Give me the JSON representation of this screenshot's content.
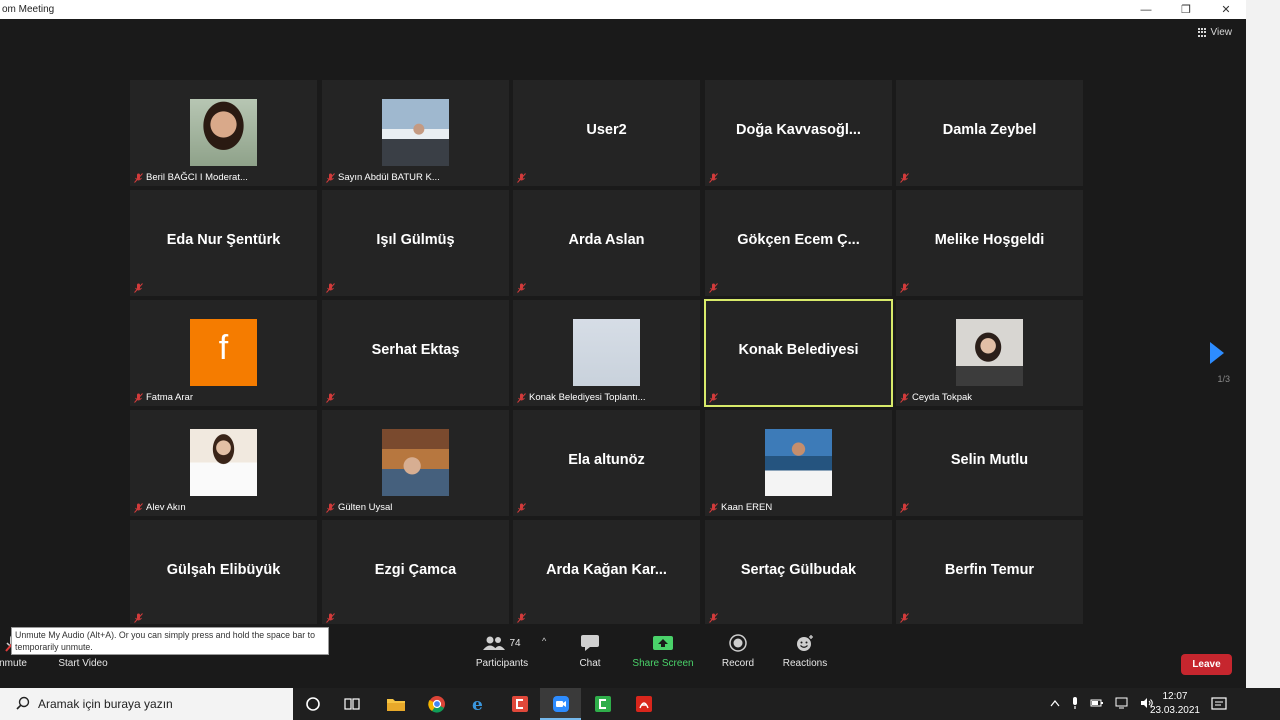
{
  "window": {
    "title": "om Meeting",
    "minimize": "—",
    "restore": "❐",
    "close": "✕"
  },
  "view_label": "View",
  "tiles": [
    {
      "name": "Beril BAĞCI I Moderat...",
      "photo": "woman-curly-hair"
    },
    {
      "name": "Sayın Abdül BATUR K...",
      "photo": "man-outdoors"
    },
    {
      "name": "User2"
    },
    {
      "name": "Doğa  Kavvasoğl..."
    },
    {
      "name": "Damla Zeybel"
    },
    {
      "name": "Eda Nur Şentürk"
    },
    {
      "name": "Işıl Gülmüş"
    },
    {
      "name": "Arda Aslan"
    },
    {
      "name": "Gökçen  Ecem  Ç..."
    },
    {
      "name": "Melike Hoşgeldi"
    },
    {
      "name": "Fatma Arar",
      "photo": "facebook-logo",
      "logo_letter": "f"
    },
    {
      "name": "Serhat Ektaş"
    },
    {
      "name": "Konak Belediyesi Toplantı...",
      "photo": "blank-light"
    },
    {
      "name": "Konak Belediyesi",
      "active": true
    },
    {
      "name": "Ceyda Tokpak",
      "photo": "woman-portrait"
    },
    {
      "name": "Alev Akın",
      "photo": "woman-white-dress"
    },
    {
      "name": "Gülten Uysal",
      "photo": "woman-lying"
    },
    {
      "name": "Ela altunöz"
    },
    {
      "name": "Kaan EREN",
      "photo": "man-seaside"
    },
    {
      "name": "Selin Mutlu"
    },
    {
      "name": "Gülşah Elibüyük"
    },
    {
      "name": "Ezgi Çamca"
    },
    {
      "name": "Arda Kağan  Kar..."
    },
    {
      "name": "Sertaç Gülbudak"
    },
    {
      "name": "Berfin Temur"
    }
  ],
  "pager": {
    "text": "1/3"
  },
  "controls": {
    "unmute": "nmute",
    "start_video": "Start Video",
    "participants": "Participants",
    "participants_count": "74",
    "chat": "Chat",
    "share_screen": "Share Screen",
    "record": "Record",
    "reactions": "Reactions",
    "leave": "Leave"
  },
  "tooltip": "Unmute My Audio (Alt+A). Or you can simply press and hold the space bar to temporarily unmute.",
  "taskbar": {
    "search_placeholder": "Aramak için buraya yazın",
    "time": "12:07",
    "date": "23.03.2021"
  },
  "colors": {
    "active_speaker": "#d8ea6a",
    "leave": "#c6262e",
    "share_screen": "#4ad26a",
    "next_arrow": "#2d8cff"
  }
}
